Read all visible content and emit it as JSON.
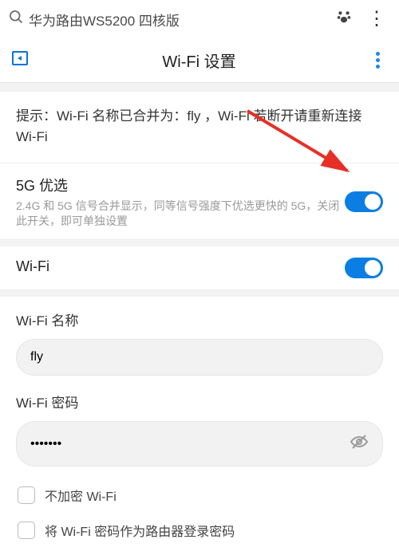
{
  "searchbar": {
    "text": "华为路由WS5200 四核版"
  },
  "header": {
    "title": "Wi-Fi 设置"
  },
  "tip": "提示：Wi-Fi 名称已合并为：fly ，Wi-Fi 若断开请重新连接 Wi-Fi",
  "pref5g": {
    "title": "5G 优选",
    "desc": "2.4G 和 5G 信号合并显示，同等信号强度下优选更快的 5G，关闭此开关，即可单独设置"
  },
  "wifi": {
    "label": "Wi-Fi"
  },
  "nameField": {
    "label": "Wi-Fi 名称",
    "value": "fly"
  },
  "pwField": {
    "label": "Wi-Fi 密码",
    "value": "•••••••"
  },
  "checks": {
    "noenc": "不加密 Wi-Fi",
    "aslogin": "将 Wi-Fi 密码作为路由器登录密码"
  }
}
